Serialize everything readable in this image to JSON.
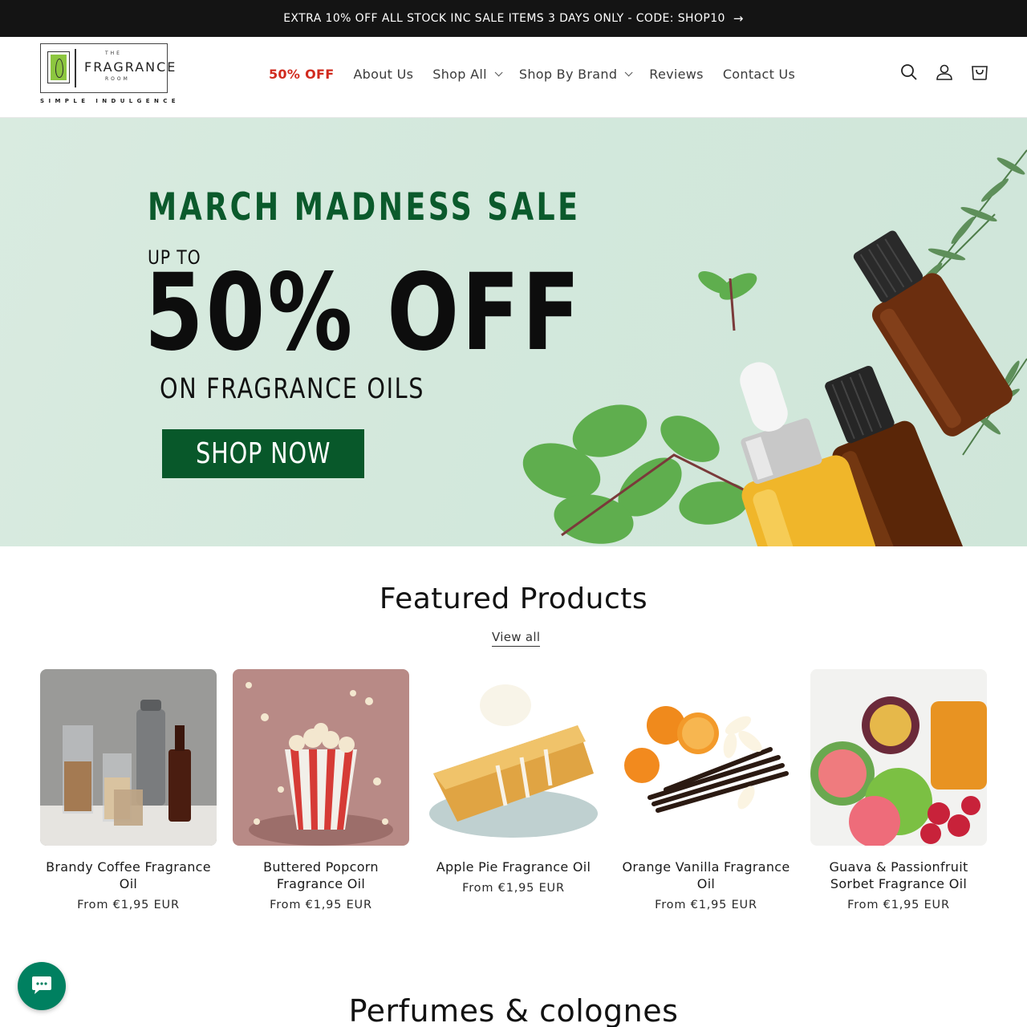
{
  "announcement": {
    "text": "EXTRA 10% OFF ALL STOCK INC SALE ITEMS 3 DAYS ONLY - CODE: SHOP10",
    "arrow": "→"
  },
  "logo": {
    "the": "THE",
    "name": "FRAGRANCE",
    "room": "ROOM",
    "tagline": "SIMPLE INDULGENCE",
    "brand_color": "#8cc63f"
  },
  "nav": {
    "items": [
      {
        "label": "50% OFF",
        "dropdown": false
      },
      {
        "label": "About Us",
        "dropdown": false
      },
      {
        "label": "Shop All",
        "dropdown": true
      },
      {
        "label": "Shop By Brand",
        "dropdown": true
      },
      {
        "label": "Reviews",
        "dropdown": false
      },
      {
        "label": "Contact Us",
        "dropdown": false
      }
    ],
    "sale_color": "#d12b1f"
  },
  "header_icons": [
    "search-icon",
    "account-icon",
    "cart-icon"
  ],
  "hero": {
    "line1": "MARCH MADNESS SALE",
    "up_to": "UP TO",
    "big": "50% OFF",
    "sub": "ON FRAGRANCE OILS",
    "button": "SHOP NOW",
    "accent": "#08582a"
  },
  "featured": {
    "title": "Featured Products",
    "view_all": "View all",
    "products": [
      {
        "name": "Brandy Coffee Fragrance Oil",
        "price": "From €1,95 EUR"
      },
      {
        "name": "Buttered Popcorn Fragrance Oil",
        "price": "From €1,95 EUR"
      },
      {
        "name": "Apple Pie Fragrance Oil",
        "price": "From €1,95 EUR"
      },
      {
        "name": "Orange Vanilla Fragrance Oil",
        "price": "From €1,95 EUR"
      },
      {
        "name": "Guava & Passionfruit Sorbet Fragrance Oil",
        "price": "From €1,95 EUR"
      }
    ]
  },
  "next_section": {
    "title": "Perfumes & colognes"
  },
  "chat": {
    "icon": "chat-icon",
    "color": "#008060"
  }
}
